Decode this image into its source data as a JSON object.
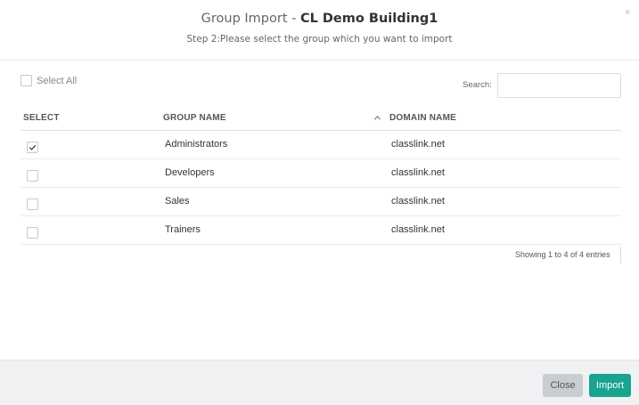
{
  "dialog": {
    "title_prefix": "Group Import - ",
    "title_building": "CL Demo Building1",
    "subtitle": "Step 2:Please select the group which you want to import",
    "close_icon": "×"
  },
  "controls": {
    "select_all_label": "Select All",
    "search_label": "Search:",
    "search_value": ""
  },
  "table": {
    "columns": [
      "SELECT",
      "GROUP NAME",
      "DOMAIN NAME"
    ],
    "sorted_column": "GROUP NAME",
    "sort_direction": "ascending",
    "rows": [
      {
        "selected": true,
        "group": "Administrators",
        "domain": "classlink.net"
      },
      {
        "selected": false,
        "group": "Developers",
        "domain": "classlink.net"
      },
      {
        "selected": false,
        "group": "Sales",
        "domain": "classlink.net"
      },
      {
        "selected": false,
        "group": "Trainers",
        "domain": "classlink.net"
      }
    ],
    "info": "Showing 1 to 4 of 4 entries"
  },
  "footer": {
    "close_label": "Close",
    "import_label": "Import"
  },
  "colors": {
    "import_button": "#1aa38f",
    "close_button": "#c9ccd1",
    "footer_background": "#f0f1f3"
  }
}
